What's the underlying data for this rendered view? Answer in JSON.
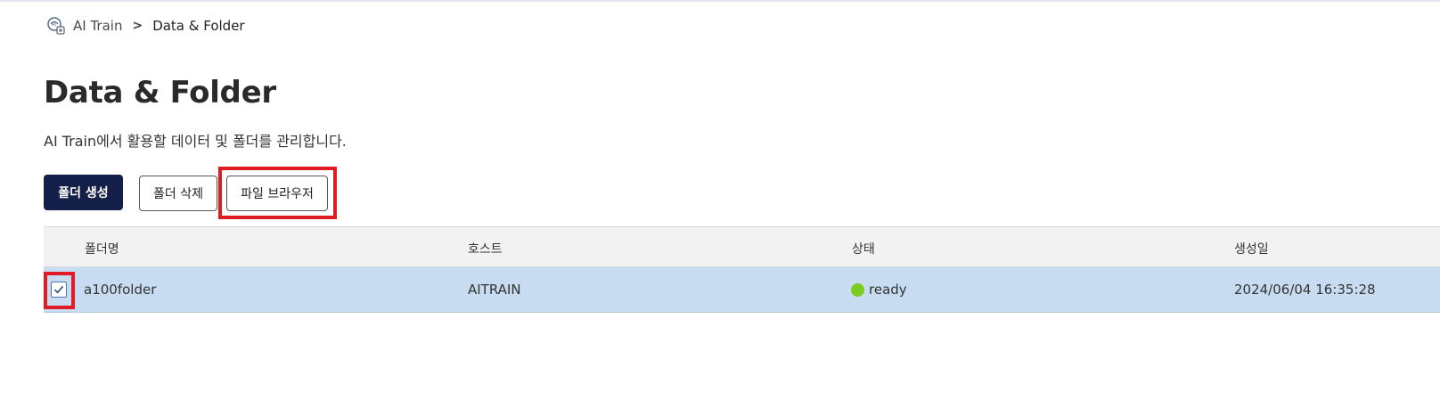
{
  "breadcrumb": {
    "icon": "ai-train-icon",
    "root": "AI Train",
    "separator": ">",
    "current": "Data & Folder"
  },
  "page": {
    "title": "Data & Folder",
    "description": "AI Train에서 활용할 데이터 및 폴더를 관리합니다."
  },
  "toolbar": {
    "create_label": "폴더 생성",
    "delete_label": "폴더 삭제",
    "browser_label": "파일 브라우저"
  },
  "table": {
    "columns": [
      "폴더명",
      "호스트",
      "상태",
      "생성일"
    ],
    "rows": [
      {
        "checked": true,
        "name": "a100folder",
        "host": "AITRAIN",
        "status": "ready",
        "status_color": "#7ccc1f",
        "created": "2024/06/04 16:35:28"
      }
    ]
  },
  "colors": {
    "primary": "#15204a",
    "row_selected": "#c7dcf1",
    "highlight": "#e01b24",
    "status_ready": "#7ccc1f"
  }
}
